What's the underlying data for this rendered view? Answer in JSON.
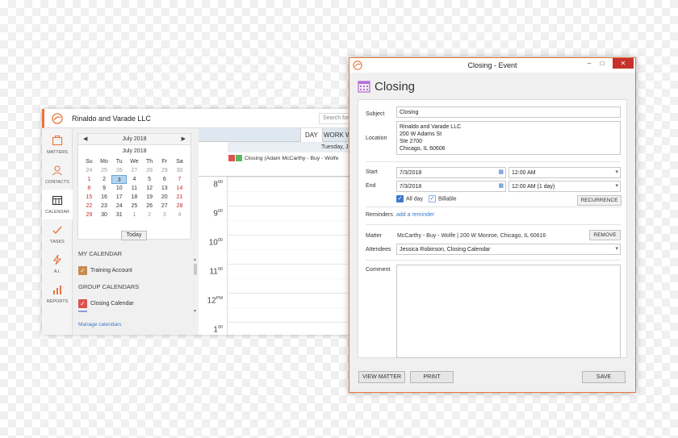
{
  "main": {
    "firm_name": "Rinaldo and Varade LLC",
    "search_placeholder": "Search for m",
    "nav": [
      {
        "label": "MATTERS",
        "icon": "briefcase-icon"
      },
      {
        "label": "CONTACTS",
        "icon": "contacts-icon"
      },
      {
        "label": "CALENDAR",
        "icon": "calendar-icon"
      },
      {
        "label": "TASKS",
        "icon": "tasks-icon"
      },
      {
        "label": "A.I.",
        "icon": "lightning-icon"
      },
      {
        "label": "REPORTS",
        "icon": "bar-chart-icon"
      }
    ],
    "mini_calendar": {
      "header": "July 2018",
      "sub_title": "July 2018",
      "weekdays": [
        "Su",
        "Mo",
        "Tu",
        "We",
        "Th",
        "Fr",
        "Sa"
      ],
      "weeks": [
        [
          "24",
          "25",
          "26",
          "27",
          "28",
          "29",
          "30"
        ],
        [
          "1",
          "2",
          "3",
          "4",
          "5",
          "6",
          "7"
        ],
        [
          "8",
          "9",
          "10",
          "11",
          "12",
          "13",
          "14"
        ],
        [
          "15",
          "16",
          "17",
          "18",
          "19",
          "20",
          "21"
        ],
        [
          "22",
          "23",
          "24",
          "25",
          "26",
          "27",
          "28"
        ],
        [
          "29",
          "30",
          "31",
          "1",
          "2",
          "3",
          "4"
        ]
      ],
      "selected_day": "3",
      "today_label": "Today"
    },
    "my_calendar_title": "MY CALENDAR",
    "my_calendars": [
      {
        "label": "Training Account",
        "color": "#c78a4e"
      }
    ],
    "group_calendars_title": "GROUP CALENDARS",
    "group_calendars": [
      {
        "label": "Closing Calendar",
        "color": "#d9534f"
      }
    ],
    "manage_link": "Manage calendars",
    "view_tabs": {
      "day": "DAY",
      "work": "WORK W"
    },
    "date_header": "Tuesday, Ju",
    "all_day_event": "Closing (Adam McCarthy - Buy - Wolfe",
    "event_colors": [
      "#d9534f",
      "#5cb85c"
    ],
    "hours": [
      {
        "num": "8",
        "suf": "00"
      },
      {
        "num": "9",
        "suf": "00"
      },
      {
        "num": "10",
        "suf": "00"
      },
      {
        "num": "11",
        "suf": "00"
      },
      {
        "num": "12",
        "suf": "PM"
      },
      {
        "num": "1",
        "suf": "00"
      }
    ]
  },
  "dialog": {
    "title": "Closing - Event",
    "controls": {
      "minimize": "–",
      "maximize": "□",
      "close": "✕"
    },
    "heading": "Closing",
    "subject_label": "Subject",
    "subject_value": "Closing",
    "location_label": "Location",
    "location_lines": [
      "Rinaldo and Varade LLC",
      "200 W Adams St",
      "Ste 2700",
      "Chicago, IL 60606"
    ],
    "start_label": "Start",
    "start_date": "7/3/2018",
    "start_time": "12:00 AM",
    "end_label": "End",
    "end_date": "7/3/2018",
    "end_time": "12:00 AM (1 day)",
    "all_day_label": "All day",
    "billable_label": "Billable",
    "recurrence_button": "RECURRENCE",
    "reminders_label": "Reminders",
    "add_reminder": "add a reminder",
    "matter_label": "Matter",
    "matter_value": "McCarthy - Buy - Wolfe | 200 W Monroe, Chicago, IL 60616",
    "remove_button": "REMOVE",
    "attendees_label": "Attendees",
    "attendees_value": "Jessica Robinson, Closing Calendar",
    "comment_label": "Comment",
    "comment_value": "",
    "buttons": {
      "view_matter": "VIEW MATTER",
      "print": "PRINT",
      "save": "SAVE"
    }
  },
  "colors": {
    "accent": "#e8743b",
    "link": "#3a7bc8",
    "close_button": "#c7312b",
    "calendar_icon": "#b76fd8"
  }
}
